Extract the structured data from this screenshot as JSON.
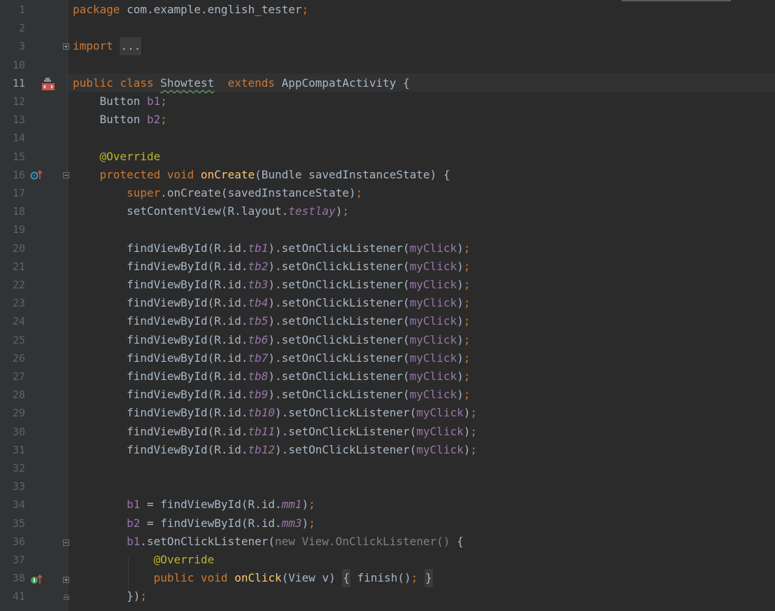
{
  "editor": {
    "lines": [
      {
        "n": "1",
        "tokens": [
          {
            "t": "package ",
            "c": "kw"
          },
          {
            "t": "com.example.english_tester"
          },
          {
            "t": ";",
            "c": "kw"
          }
        ]
      },
      {
        "n": "2",
        "tokens": []
      },
      {
        "n": "3",
        "tokens": [
          {
            "t": "import ",
            "c": "kw"
          },
          {
            "t": "...",
            "c": "fold"
          }
        ]
      },
      {
        "n": "10",
        "tokens": []
      },
      {
        "n": "11",
        "tokens": [
          {
            "t": "public ",
            "c": "kw"
          },
          {
            "t": "class ",
            "c": "kw"
          },
          {
            "t": "Showtest",
            "c": "cls"
          },
          {
            "t": "  "
          },
          {
            "t": "extends ",
            "c": "kw"
          },
          {
            "t": "AppCompatActivity {"
          }
        ]
      },
      {
        "n": "12",
        "tokens": [
          {
            "t": "    Button "
          },
          {
            "t": "b1",
            "c": "fld"
          },
          {
            "t": ";",
            "c": "kw"
          }
        ]
      },
      {
        "n": "13",
        "tokens": [
          {
            "t": "    Button "
          },
          {
            "t": "b2",
            "c": "fld"
          },
          {
            "t": ";",
            "c": "kw"
          }
        ]
      },
      {
        "n": "14",
        "tokens": []
      },
      {
        "n": "15",
        "tokens": [
          {
            "t": "    "
          },
          {
            "t": "@Override",
            "c": "ann"
          }
        ]
      },
      {
        "n": "16",
        "tokens": [
          {
            "t": "    "
          },
          {
            "t": "protected ",
            "c": "kw"
          },
          {
            "t": "void ",
            "c": "kw"
          },
          {
            "t": "onCreate",
            "c": "fn"
          },
          {
            "t": "(Bundle savedInstanceState) {"
          }
        ]
      },
      {
        "n": "17",
        "tokens": [
          {
            "t": "        "
          },
          {
            "t": "super",
            "c": "kw"
          },
          {
            "t": ".onCreate(savedInstanceState)"
          },
          {
            "t": ";",
            "c": "kw"
          }
        ]
      },
      {
        "n": "18",
        "tokens": [
          {
            "t": "        setContentView(R.layout."
          },
          {
            "t": "testlay",
            "c": "fldi"
          },
          {
            "t": ")"
          },
          {
            "t": ";",
            "c": "kw"
          }
        ]
      },
      {
        "n": "19",
        "tokens": []
      },
      {
        "n": "20",
        "tokens": [
          {
            "t": "        findViewById(R.id."
          },
          {
            "t": "tb1",
            "c": "fldi"
          },
          {
            "t": ").setOnClickListener("
          },
          {
            "t": "myClick",
            "c": "fld"
          },
          {
            "t": ")"
          },
          {
            "t": ";",
            "c": "kw"
          }
        ]
      },
      {
        "n": "21",
        "tokens": [
          {
            "t": "        findViewById(R.id."
          },
          {
            "t": "tb2",
            "c": "fldi"
          },
          {
            "t": ").setOnClickListener("
          },
          {
            "t": "myClick",
            "c": "fld"
          },
          {
            "t": ")"
          },
          {
            "t": ";",
            "c": "kw"
          }
        ]
      },
      {
        "n": "22",
        "tokens": [
          {
            "t": "        findViewById(R.id."
          },
          {
            "t": "tb3",
            "c": "fldi"
          },
          {
            "t": ").setOnClickListener("
          },
          {
            "t": "myClick",
            "c": "fld"
          },
          {
            "t": ")"
          },
          {
            "t": ";",
            "c": "kw"
          }
        ]
      },
      {
        "n": "23",
        "tokens": [
          {
            "t": "        findViewById(R.id."
          },
          {
            "t": "tb4",
            "c": "fldi"
          },
          {
            "t": ").setOnClickListener("
          },
          {
            "t": "myClick",
            "c": "fld"
          },
          {
            "t": ")"
          },
          {
            "t": ";",
            "c": "kw"
          }
        ]
      },
      {
        "n": "24",
        "tokens": [
          {
            "t": "        findViewById(R.id."
          },
          {
            "t": "tb5",
            "c": "fldi"
          },
          {
            "t": ").setOnClickListener("
          },
          {
            "t": "myClick",
            "c": "fld"
          },
          {
            "t": ")"
          },
          {
            "t": ";",
            "c": "kw"
          }
        ]
      },
      {
        "n": "25",
        "tokens": [
          {
            "t": "        findViewById(R.id."
          },
          {
            "t": "tb6",
            "c": "fldi"
          },
          {
            "t": ").setOnClickListener("
          },
          {
            "t": "myClick",
            "c": "fld"
          },
          {
            "t": ")"
          },
          {
            "t": ";",
            "c": "kw"
          }
        ]
      },
      {
        "n": "26",
        "tokens": [
          {
            "t": "        findViewById(R.id."
          },
          {
            "t": "tb7",
            "c": "fldi"
          },
          {
            "t": ").setOnClickListener("
          },
          {
            "t": "myClick",
            "c": "fld"
          },
          {
            "t": ")"
          },
          {
            "t": ";",
            "c": "kw"
          }
        ]
      },
      {
        "n": "27",
        "tokens": [
          {
            "t": "        findViewById(R.id."
          },
          {
            "t": "tb8",
            "c": "fldi"
          },
          {
            "t": ").setOnClickListener("
          },
          {
            "t": "myClick",
            "c": "fld"
          },
          {
            "t": ")"
          },
          {
            "t": ";",
            "c": "kw"
          }
        ]
      },
      {
        "n": "28",
        "tokens": [
          {
            "t": "        findViewById(R.id."
          },
          {
            "t": "tb9",
            "c": "fldi"
          },
          {
            "t": ").setOnClickListener("
          },
          {
            "t": "myClick",
            "c": "fld"
          },
          {
            "t": ")"
          },
          {
            "t": ";",
            "c": "kw"
          }
        ]
      },
      {
        "n": "29",
        "tokens": [
          {
            "t": "        findViewById(R.id."
          },
          {
            "t": "tb10",
            "c": "fldi"
          },
          {
            "t": ").setOnClickListener("
          },
          {
            "t": "myClick",
            "c": "fld"
          },
          {
            "t": ")"
          },
          {
            "t": ";",
            "c": "kw"
          }
        ]
      },
      {
        "n": "30",
        "tokens": [
          {
            "t": "        findViewById(R.id."
          },
          {
            "t": "tb11",
            "c": "fldi"
          },
          {
            "t": ").setOnClickListener("
          },
          {
            "t": "myClick",
            "c": "fld"
          },
          {
            "t": ")"
          },
          {
            "t": ";",
            "c": "kw"
          }
        ]
      },
      {
        "n": "31",
        "tokens": [
          {
            "t": "        findViewById(R.id."
          },
          {
            "t": "tb12",
            "c": "fldi"
          },
          {
            "t": ").setOnClickListener("
          },
          {
            "t": "myClick",
            "c": "fld"
          },
          {
            "t": ")"
          },
          {
            "t": ";",
            "c": "kw"
          }
        ]
      },
      {
        "n": "32",
        "tokens": []
      },
      {
        "n": "33",
        "tokens": []
      },
      {
        "n": "34",
        "tokens": [
          {
            "t": "        "
          },
          {
            "t": "b1",
            "c": "fld"
          },
          {
            "t": " = findViewById(R.id."
          },
          {
            "t": "mm1",
            "c": "fldi"
          },
          {
            "t": ")"
          },
          {
            "t": ";",
            "c": "kw"
          }
        ]
      },
      {
        "n": "35",
        "tokens": [
          {
            "t": "        "
          },
          {
            "t": "b2",
            "c": "fld"
          },
          {
            "t": " = findViewById(R.id."
          },
          {
            "t": "mm3",
            "c": "fldi"
          },
          {
            "t": ")"
          },
          {
            "t": ";",
            "c": "kw"
          }
        ]
      },
      {
        "n": "36",
        "tokens": [
          {
            "t": "        "
          },
          {
            "t": "b1",
            "c": "fld"
          },
          {
            "t": ".setOnClickListener("
          },
          {
            "t": "new View.OnClickListener()",
            "c": "gray"
          },
          {
            "t": " {"
          }
        ]
      },
      {
        "n": "37",
        "tokens": [
          {
            "t": "            "
          },
          {
            "t": "@Override",
            "c": "ann"
          }
        ]
      },
      {
        "n": "38",
        "tokens": [
          {
            "t": "            "
          },
          {
            "t": "public ",
            "c": "kw"
          },
          {
            "t": "void ",
            "c": "kw"
          },
          {
            "t": "onClick",
            "c": "fn"
          },
          {
            "t": "(View v) "
          },
          {
            "t": "{",
            "c": "foldg"
          },
          {
            "t": " finish()"
          },
          {
            "t": ";",
            "c": "kw"
          },
          {
            "t": " "
          },
          {
            "t": "}",
            "c": "foldg"
          }
        ]
      },
      {
        "n": "41",
        "tokens": [
          {
            "t": "        })"
          },
          {
            "t": ";",
            "c": "kw"
          }
        ]
      }
    ]
  },
  "gutter": {
    "active_line": "11",
    "icons": [
      {
        "line": "11",
        "name": "class-layout-icon"
      },
      {
        "line": "16",
        "name": "override-method-icon"
      },
      {
        "line": "38",
        "name": "implement-method-icon"
      }
    ]
  },
  "colors": {
    "background": "#2b2b2b",
    "gutter": "#313335",
    "keyword": "#cc7832",
    "annotation": "#bbb529",
    "function": "#ffc66d",
    "field": "#9876aa",
    "text": "#a9b7c6"
  }
}
